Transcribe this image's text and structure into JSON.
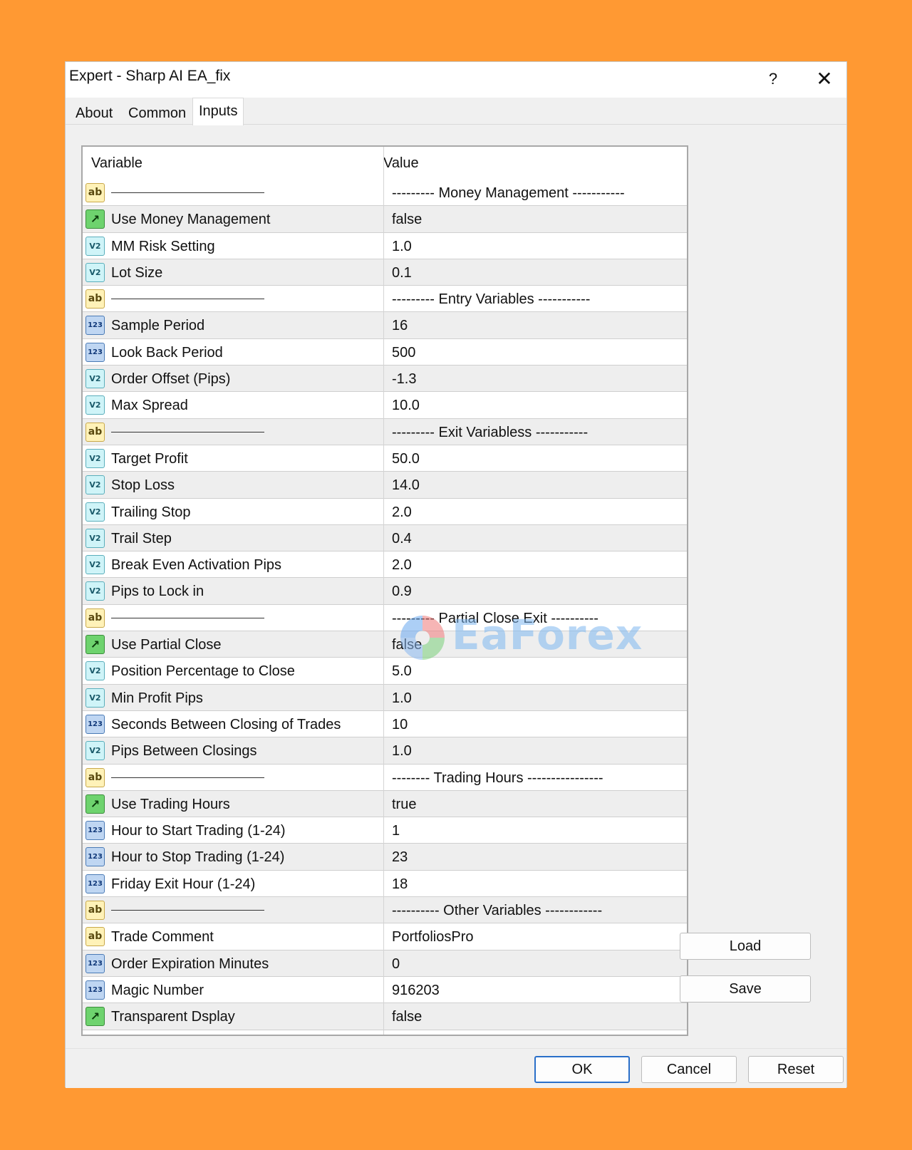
{
  "window": {
    "title": "Expert - Sharp AI EA_fix",
    "help_label": "?",
    "close_label": "✕"
  },
  "tabs": [
    {
      "label": "About"
    },
    {
      "label": "Common"
    },
    {
      "label": "Inputs",
      "active": true
    }
  ],
  "grid": {
    "headers": {
      "variable": "Variable",
      "value": "Value"
    },
    "rows": [
      {
        "type": "section",
        "icon": "ab",
        "value": "--------- Money Management -----------"
      },
      {
        "type": "bool",
        "icon": "bool",
        "variable": "Use Money Management",
        "value": "false"
      },
      {
        "type": "double",
        "icon": "V2",
        "variable": "MM Risk Setting",
        "value": "1.0"
      },
      {
        "type": "double",
        "icon": "V2",
        "variable": "Lot Size",
        "value": "0.1"
      },
      {
        "type": "section",
        "icon": "ab",
        "value": "--------- Entry Variables -----------"
      },
      {
        "type": "int",
        "icon": "123",
        "variable": "Sample Period",
        "value": "16"
      },
      {
        "type": "int",
        "icon": "123",
        "variable": "Look Back Period",
        "value": "500"
      },
      {
        "type": "double",
        "icon": "V2",
        "variable": "Order Offset (Pips)",
        "value": "-1.3"
      },
      {
        "type": "double",
        "icon": "V2",
        "variable": "Max Spread",
        "value": "10.0"
      },
      {
        "type": "section",
        "icon": "ab",
        "value": "--------- Exit Variabless -----------"
      },
      {
        "type": "double",
        "icon": "V2",
        "variable": "Target Profit",
        "value": "50.0"
      },
      {
        "type": "double",
        "icon": "V2",
        "variable": "Stop Loss",
        "value": "14.0"
      },
      {
        "type": "double",
        "icon": "V2",
        "variable": "Trailing Stop",
        "value": "2.0"
      },
      {
        "type": "double",
        "icon": "V2",
        "variable": "Trail Step",
        "value": "0.4"
      },
      {
        "type": "double",
        "icon": "V2",
        "variable": "Break Even Activation Pips",
        "value": "2.0"
      },
      {
        "type": "double",
        "icon": "V2",
        "variable": "Pips to Lock in",
        "value": "0.9"
      },
      {
        "type": "section",
        "icon": "ab",
        "value": "--------- Partial Close Exit ----------"
      },
      {
        "type": "bool",
        "icon": "bool",
        "variable": "Use Partial Close",
        "value": "false"
      },
      {
        "type": "double",
        "icon": "V2",
        "variable": "Position Percentage to Close",
        "value": "5.0"
      },
      {
        "type": "double",
        "icon": "V2",
        "variable": "Min Profit Pips",
        "value": "1.0"
      },
      {
        "type": "int",
        "icon": "123",
        "variable": "Seconds Between Closing of Trades",
        "value": "10"
      },
      {
        "type": "double",
        "icon": "V2",
        "variable": "Pips Between Closings",
        "value": "1.0"
      },
      {
        "type": "section",
        "icon": "ab",
        "value": "-------- Trading Hours ----------------"
      },
      {
        "type": "bool",
        "icon": "bool",
        "variable": "Use Trading Hours",
        "value": "true"
      },
      {
        "type": "int",
        "icon": "123",
        "variable": "Hour to Start Trading (1-24)",
        "value": "1"
      },
      {
        "type": "int",
        "icon": "123",
        "variable": "Hour to Stop Trading (1-24)",
        "value": "23"
      },
      {
        "type": "int",
        "icon": "123",
        "variable": "Friday Exit Hour (1-24)",
        "value": "18"
      },
      {
        "type": "section",
        "icon": "ab",
        "value": "---------- Other Variables ------------"
      },
      {
        "type": "string",
        "icon": "ab",
        "variable": "Trade Comment",
        "value": "PortfoliosPro"
      },
      {
        "type": "int",
        "icon": "123",
        "variable": "Order Expiration Minutes",
        "value": "0"
      },
      {
        "type": "int",
        "icon": "123",
        "variable": "Magic Number",
        "value": "916203"
      },
      {
        "type": "bool",
        "icon": "bool",
        "variable": "Transparent Dsplay",
        "value": "false"
      }
    ]
  },
  "side_buttons": {
    "load": "Load",
    "save": "Save"
  },
  "footer_buttons": {
    "ok": "OK",
    "cancel": "Cancel",
    "reset": "Reset"
  },
  "watermark": {
    "text": "EaForex"
  },
  "colors": {
    "background": "#FF9933",
    "dialog": "#F0F0F0",
    "ok_border": "#2a6fc9"
  }
}
